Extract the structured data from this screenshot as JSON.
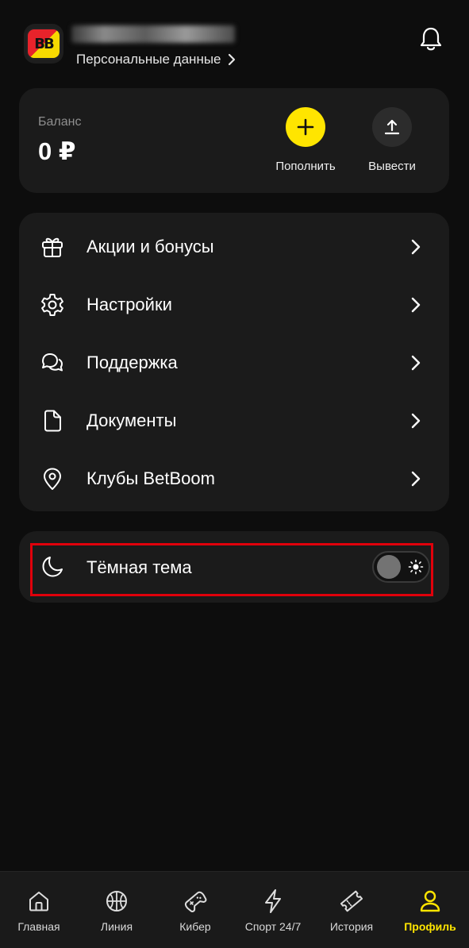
{
  "header": {
    "personal_data_label": "Персональные данные"
  },
  "balance": {
    "label": "Баланс",
    "value": "0 ₽",
    "deposit_label": "Пополнить",
    "withdraw_label": "Вывести"
  },
  "menu": {
    "items": [
      {
        "label": "Акции и бонусы",
        "icon": "gift-icon"
      },
      {
        "label": "Настройки",
        "icon": "gear-icon"
      },
      {
        "label": "Поддержка",
        "icon": "chat-icon"
      },
      {
        "label": "Документы",
        "icon": "document-icon"
      },
      {
        "label": "Клубы BetBoom",
        "icon": "location-pin-icon"
      }
    ]
  },
  "theme": {
    "label": "Тёмная тема",
    "dark_mode_on": false
  },
  "tabbar": {
    "tabs": [
      {
        "label": "Главная",
        "icon": "home-icon"
      },
      {
        "label": "Линия",
        "icon": "basketball-icon"
      },
      {
        "label": "Кибер",
        "icon": "gamepad-icon"
      },
      {
        "label": "Спорт 24/7",
        "icon": "lightning-icon"
      },
      {
        "label": "История",
        "icon": "ticket-icon"
      },
      {
        "label": "Профиль",
        "icon": "user-icon"
      }
    ],
    "active": "Профиль"
  },
  "colors": {
    "accent": "#ffe500",
    "background": "#0d0d0d",
    "card": "#1b1b1b",
    "highlight": "#e0000b"
  }
}
